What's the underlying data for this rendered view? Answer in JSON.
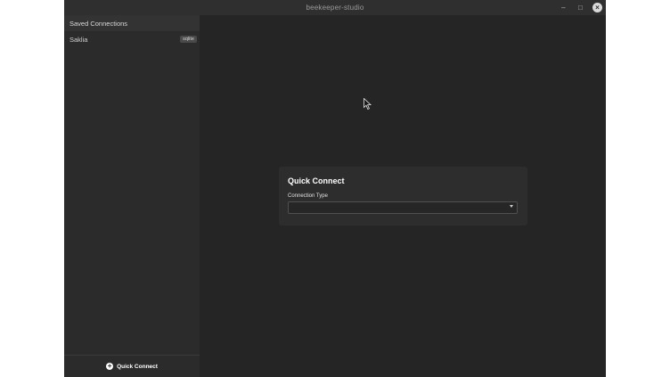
{
  "window": {
    "title": "beekeeper-studio",
    "controls": {
      "minimize_icon": "–",
      "maximize_icon": "□",
      "close_icon": "×"
    }
  },
  "sidebar": {
    "header": "Saved Connections",
    "connections": [
      {
        "name": "Saklia",
        "badge": "sqlite"
      }
    ],
    "footer": {
      "icon": "+",
      "label": "Quick Connect"
    }
  },
  "quick_connect": {
    "title": "Quick Connect",
    "connection_type_label": "Connection Type",
    "connection_type_value": ""
  },
  "colors": {
    "window_bg": "#252525",
    "sidebar_bg": "#2b2b2b",
    "card_bg": "#2d2d2d",
    "titlebar_bg": "#2f2f2f"
  }
}
